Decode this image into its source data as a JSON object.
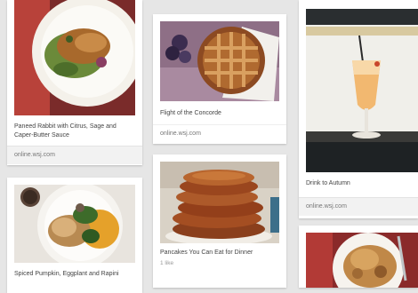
{
  "pins": [
    {
      "description": "Paneed Rabbit with Citrus, Sage and Caper-Butter Sauce",
      "source": "online.wsj.com"
    },
    {
      "description": "Flight of the Concorde",
      "source": "online.wsj.com"
    },
    {
      "description": "Drink to Autumn",
      "source": "online.wsj.com"
    },
    {
      "description": "Spiced Pumpkin, Eggplant and Rapini"
    },
    {
      "description": "Pancakes You Can Eat for Dinner",
      "meta": "1 like"
    },
    {
      "description": ""
    }
  ],
  "icons": [
    "rabbit-dish-image",
    "pie-image",
    "cocktail-image",
    "pumpkin-dish-image",
    "pancakes-image",
    "casserole-image"
  ]
}
